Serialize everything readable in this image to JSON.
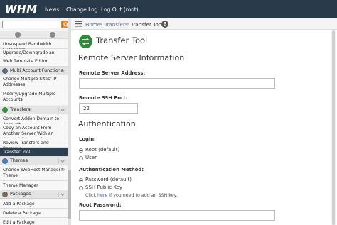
{
  "app": {
    "logo": "WHM",
    "nav": [
      {
        "label": "News"
      },
      {
        "label": "Change Log"
      },
      {
        "label": "Log Out (root)"
      }
    ]
  },
  "sidebar": {
    "search": {
      "value": "",
      "placeholder": ""
    },
    "items_top": [
      {
        "label": "Unsuspend Bandwidth Exceeders"
      },
      {
        "label": "Upgrade/Downgrade an Account"
      },
      {
        "label": "Web Template Editor"
      }
    ],
    "group_multi": {
      "label": "Multi Account Functions"
    },
    "items_multi": [
      {
        "label": "Change Multiple Sites' IP Addresses"
      },
      {
        "label": "Modify/Upgrade Multiple Accounts"
      }
    ],
    "group_transfers": {
      "label": "Transfers"
    },
    "items_transfers": [
      {
        "label": "Convert Addon Domain to Account"
      },
      {
        "label": "Copy an Account From Another Server With an Account Password"
      },
      {
        "label": "Review Transfers and Restores"
      },
      {
        "label": "Transfer Tool"
      }
    ],
    "group_themes": {
      "label": "Themes"
    },
    "items_themes": [
      {
        "label": "Change WebHost Manager® Theme"
      },
      {
        "label": "Theme Manager"
      }
    ],
    "group_packages": {
      "label": "Packages"
    },
    "items_packages": [
      {
        "label": "Add a Package"
      },
      {
        "label": "Delete a Package"
      },
      {
        "label": "Edit a Package"
      }
    ]
  },
  "breadcrumb": {
    "home": "Home",
    "sep": "»",
    "transfers": "Transfers",
    "current": "Transfer Tool",
    "help": "?"
  },
  "main": {
    "title": "Transfer Tool",
    "remote_section": "Remote Server Information",
    "address_label": "Remote Server Address:",
    "address_value": "",
    "port_label": "Remote SSH Port:",
    "port_value": "22",
    "auth_section": "Authentication",
    "login_label": "Login:",
    "login_options": [
      {
        "label": "Root (default)",
        "selected": true
      },
      {
        "label": "User",
        "selected": false
      }
    ],
    "method_label": "Authentication Method:",
    "method_options": [
      {
        "label": "Password (default)",
        "selected": true
      },
      {
        "label": "SSH Public Key",
        "selected": false
      }
    ],
    "hint_prefix": "Click",
    "hint_link": "here",
    "hint_suffix": "if you need to add an SSH key.",
    "root_password_label": "Root Password:",
    "root_password_value": ""
  },
  "colors": {
    "topbar": "#293a4a",
    "active_item": "#2c3e50",
    "search_button": "#f48a21",
    "link": "#5a7aa0"
  }
}
